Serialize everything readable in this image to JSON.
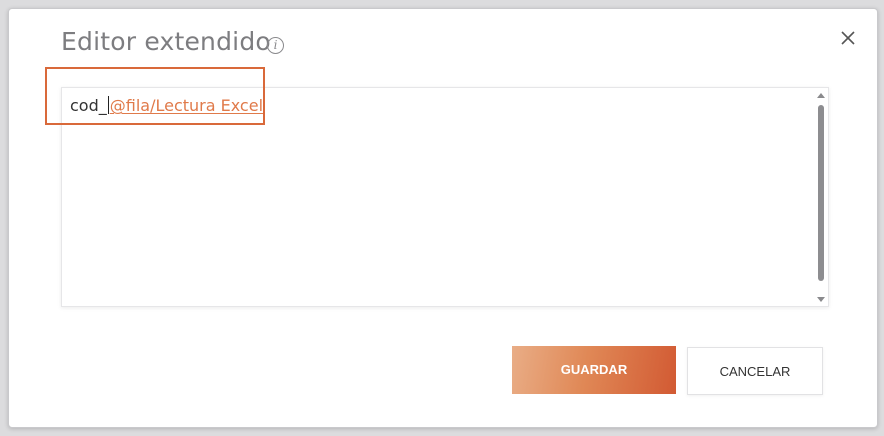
{
  "dialog": {
    "title": "Editor extendido",
    "info_icon": "info-icon",
    "close_icon": "close-icon"
  },
  "editor": {
    "text_before_caret": "cod_",
    "token": "@fila/Lectura Excel"
  },
  "buttons": {
    "save_label": "GUARDAR",
    "cancel_label": "CANCELAR"
  },
  "colors": {
    "accent": "#d9693a",
    "token_link": "#e07a4a"
  }
}
